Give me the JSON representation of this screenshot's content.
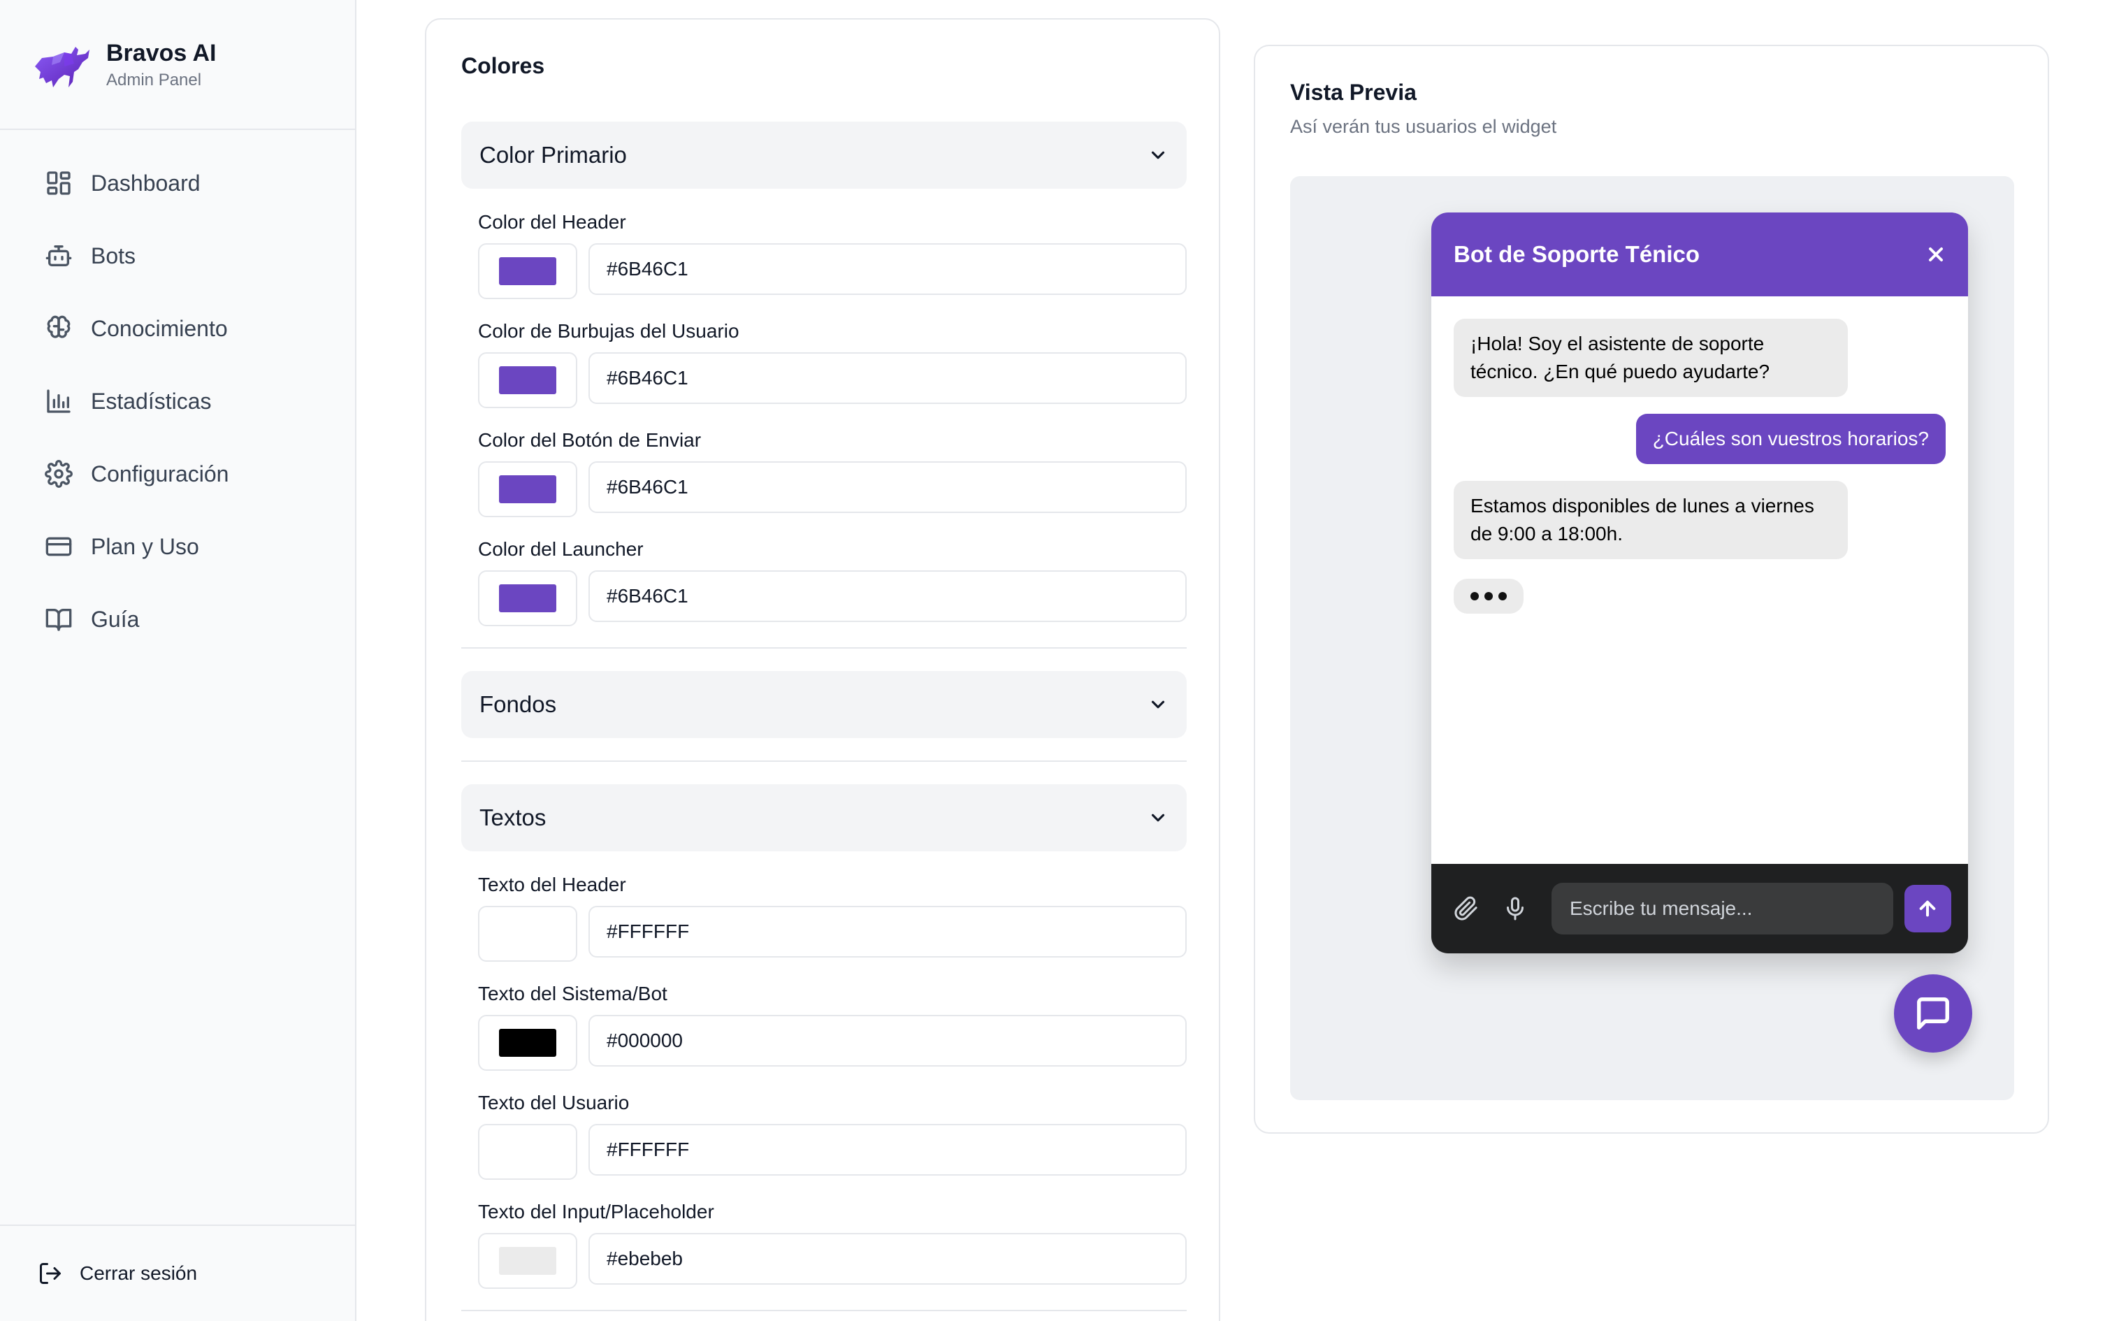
{
  "sidebar": {
    "brand": {
      "name": "Bravos AI",
      "subtitle": "Admin Panel",
      "logo_icon": "bull-logo-icon"
    },
    "items": [
      {
        "label": "Dashboard",
        "icon": "layout-grid-icon"
      },
      {
        "label": "Bots",
        "icon": "bot-icon"
      },
      {
        "label": "Conocimiento",
        "icon": "brain-icon"
      },
      {
        "label": "Estadísticas",
        "icon": "bar-chart-icon"
      },
      {
        "label": "Configuración",
        "icon": "gear-icon"
      },
      {
        "label": "Plan y Uso",
        "icon": "credit-card-icon"
      },
      {
        "label": "Guía",
        "icon": "book-open-icon"
      }
    ],
    "logout_label": "Cerrar sesión"
  },
  "colors_card": {
    "title": "Colores",
    "sections": {
      "primary": {
        "title": "Color Primario",
        "fields": [
          {
            "label": "Color del Header",
            "value": "#6B46C1",
            "swatch": "#6B46C1"
          },
          {
            "label": "Color de Burbujas del Usuario",
            "value": "#6B46C1",
            "swatch": "#6B46C1"
          },
          {
            "label": "Color del Botón de Enviar",
            "value": "#6B46C1",
            "swatch": "#6B46C1"
          },
          {
            "label": "Color del Launcher",
            "value": "#6B46C1",
            "swatch": "#6B46C1"
          }
        ]
      },
      "backgrounds": {
        "title": "Fondos"
      },
      "texts": {
        "title": "Textos",
        "fields": [
          {
            "label": "Texto del Header",
            "value": "#FFFFFF",
            "swatch": "#FFFFFF"
          },
          {
            "label": "Texto del Sistema/Bot",
            "value": "#000000",
            "swatch": "#000000"
          },
          {
            "label": "Texto del Usuario",
            "value": "#FFFFFF",
            "swatch": "#FFFFFF"
          },
          {
            "label": "Texto del Input/Placeholder",
            "value": "#ebebeb",
            "swatch": "#ebebeb"
          }
        ]
      }
    }
  },
  "preview": {
    "title": "Vista Previa",
    "subtitle": "Así verán tus usuarios el widget",
    "chat": {
      "header_title": "Bot de Soporte Ténico",
      "messages": [
        {
          "from": "bot",
          "text": "¡Hola! Soy el asistente de soporte técnico. ¿En qué puedo ayudarte?"
        },
        {
          "from": "user",
          "text": "¿Cuáles son vuestros horarios?"
        },
        {
          "from": "bot",
          "text": "Estamos disponibles de lunes a viernes de 9:00 a 18:00h."
        }
      ],
      "input_placeholder": "Escribe tu mensaje...",
      "primary_color": "#6B46C1"
    }
  }
}
